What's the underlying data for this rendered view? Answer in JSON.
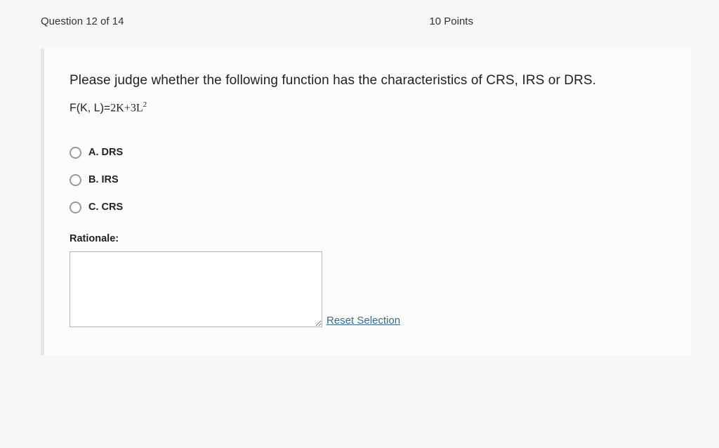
{
  "header": {
    "question_counter": "Question 12 of 14",
    "points": "10 Points"
  },
  "question": {
    "prompt": "Please judge whether the following function has the characteristics of CRS, IRS or DRS.",
    "formula_prefix": "F(K, L)=",
    "formula_body": "2K+3L",
    "formula_exponent": "2"
  },
  "options": [
    {
      "label": "A. DRS"
    },
    {
      "label": "B. IRS"
    },
    {
      "label": "C. CRS"
    }
  ],
  "rationale": {
    "label": "Rationale:",
    "value": ""
  },
  "actions": {
    "reset": "Reset Selection"
  }
}
